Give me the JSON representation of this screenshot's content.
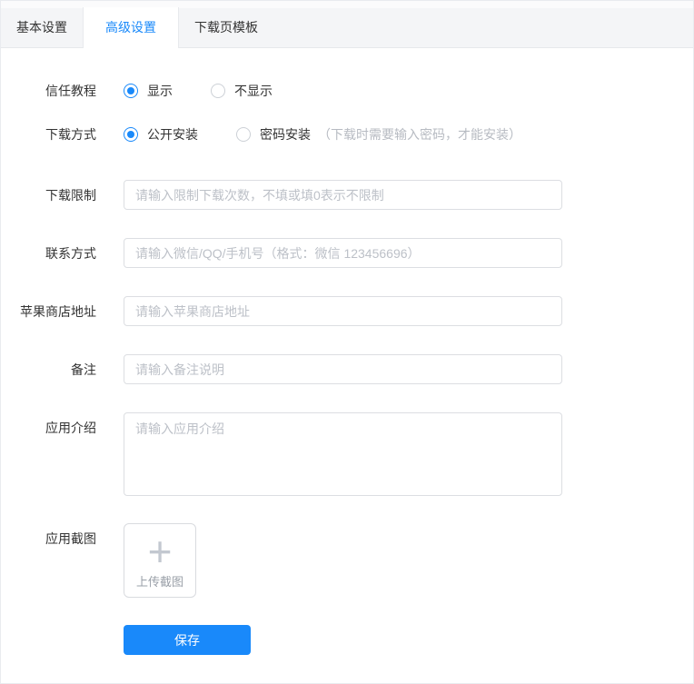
{
  "colors": {
    "accent": "#1989fa",
    "header_bg": "#f4f5f7",
    "input_border": "#dcdee2",
    "placeholder": "#bdc1c8",
    "label_text": "#333333"
  },
  "tabs": [
    {
      "label": "基本设置",
      "active": false
    },
    {
      "label": "高级设置",
      "active": true
    },
    {
      "label": "下载页模板",
      "active": false
    }
  ],
  "form": {
    "trust": {
      "label": "信任教程",
      "options": [
        {
          "label": "显示",
          "selected": true
        },
        {
          "label": "不显示",
          "selected": false
        }
      ]
    },
    "method": {
      "label": "下载方式",
      "options": [
        {
          "label": "公开安装",
          "selected": true,
          "hint": ""
        },
        {
          "label": "密码安装",
          "selected": false,
          "hint": "（下载时需要输入密码，才能安装）"
        }
      ]
    },
    "limit": {
      "label": "下载限制",
      "value": "",
      "placeholder": "请输入限制下载次数，不填或填0表示不限制"
    },
    "contact": {
      "label": "联系方式",
      "value": "",
      "placeholder": "请输入微信/QQ/手机号（格式：微信 123456696）"
    },
    "apple": {
      "label": "苹果商店地址",
      "value": "",
      "placeholder": "请输入苹果商店地址"
    },
    "remark": {
      "label": "备注",
      "value": "",
      "placeholder": "请输入备注说明"
    },
    "intro": {
      "label": "应用介绍",
      "value": "",
      "placeholder": "请输入应用介绍"
    },
    "screenshot": {
      "label": "应用截图",
      "upload_label": "上传截图",
      "plus_icon": "+"
    }
  },
  "actions": {
    "save_label": "保存"
  }
}
